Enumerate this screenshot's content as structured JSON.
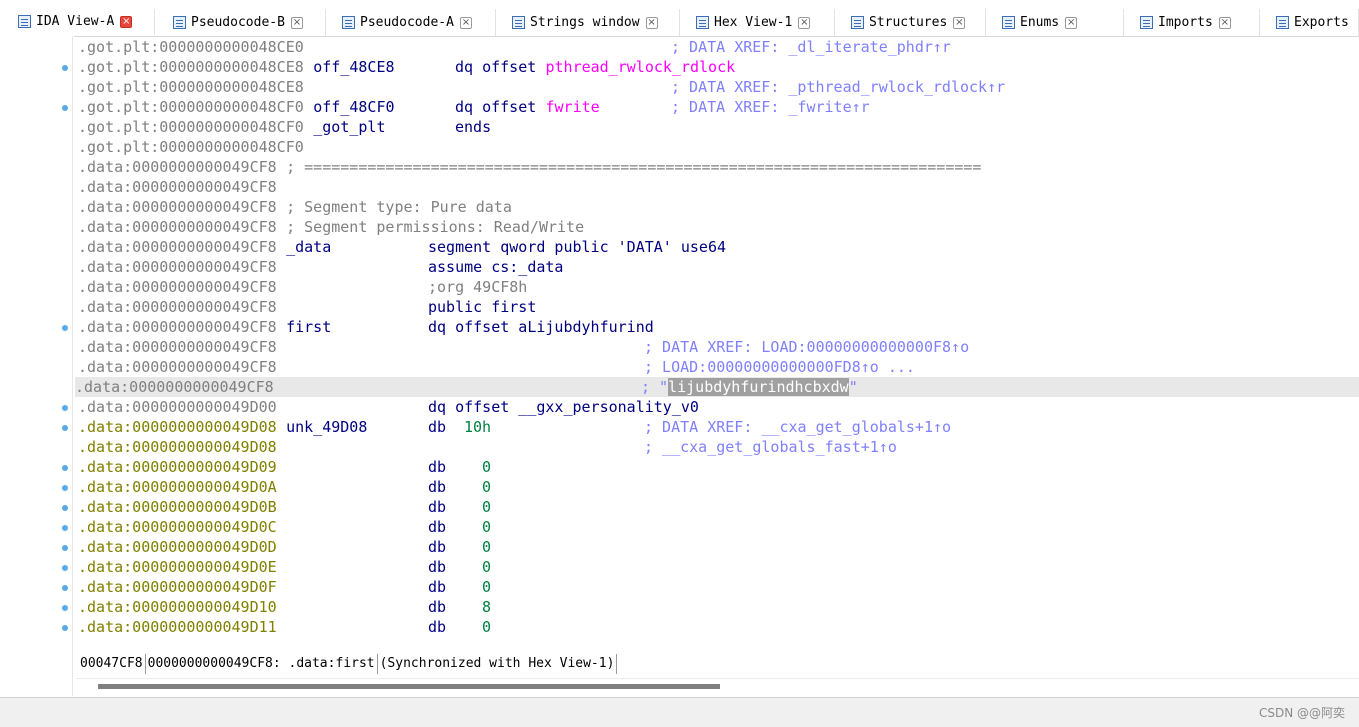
{
  "tabs": [
    {
      "label": "IDA View-A",
      "icon": "ida-view-icon",
      "active": true
    },
    {
      "label": "Pseudocode-B",
      "icon": "pseudocode-icon",
      "active": false
    },
    {
      "label": "Pseudocode-A",
      "icon": "pseudocode-icon",
      "active": false
    },
    {
      "label": "Strings window",
      "icon": "strings-icon",
      "active": false
    },
    {
      "label": "Hex View-1",
      "icon": "hex-view-icon",
      "active": false
    },
    {
      "label": "Structures",
      "icon": "structures-icon",
      "active": false
    },
    {
      "label": "Enums",
      "icon": "enums-icon",
      "active": false
    },
    {
      "label": "Imports",
      "icon": "imports-icon",
      "active": false
    },
    {
      "label": "Exports",
      "icon": "exports-icon",
      "active": false
    }
  ],
  "close_glyph": "×",
  "listing": [
    {
      "addr": ".got.plt:0000000000048CE0",
      "addr_color": "gray",
      "name": "",
      "mnem": "",
      "op": "",
      "comment": "; DATA XREF: _dl_iterate_phdr↑r",
      "dot": false
    },
    {
      "addr": ".got.plt:0000000000048CE8",
      "addr_color": "gray",
      "name": "off_48CE8",
      "mnem": "dq offset",
      "op": "pthread_rwlock_rdlock",
      "op_color": "purple",
      "comment": "",
      "dot": true
    },
    {
      "addr": ".got.plt:0000000000048CE8",
      "addr_color": "gray",
      "name": "",
      "mnem": "",
      "op": "",
      "comment": "; DATA XREF: _pthread_rwlock_rdlock↑r",
      "dot": false
    },
    {
      "addr": ".got.plt:0000000000048CF0",
      "addr_color": "gray",
      "name": "off_48CF0",
      "mnem": "dq offset",
      "op": "fwrite",
      "op_color": "purple",
      "comment": "; DATA XREF: _fwrite↑r",
      "dot": true
    },
    {
      "addr": ".got.plt:0000000000048CF0",
      "addr_color": "gray",
      "name": "_got_plt",
      "mnem": "ends",
      "op": "",
      "comment": "",
      "dot": false
    },
    {
      "addr": ".got.plt:0000000000048CF0",
      "addr_color": "gray",
      "name": "",
      "mnem": "",
      "op": "",
      "comment": "",
      "dot": false
    },
    {
      "addr": ".data:0000000000049CF8",
      "addr_color": "gray",
      "raw": "; ===========================================================================",
      "dot": false
    },
    {
      "addr": ".data:0000000000049CF8",
      "addr_color": "gray",
      "raw": "",
      "dot": false
    },
    {
      "addr": ".data:0000000000049CF8",
      "addr_color": "gray",
      "raw": "; Segment type: Pure data",
      "dot": false
    },
    {
      "addr": ".data:0000000000049CF8",
      "addr_color": "gray",
      "raw": "; Segment permissions: Read/Write",
      "dot": false
    },
    {
      "addr": ".data:0000000000049CF8",
      "addr_color": "gray",
      "name": "_data",
      "mnem": "segment qword public 'DATA' use64",
      "op": "",
      "comment": "",
      "dot": false
    },
    {
      "addr": ".data:0000000000049CF8",
      "addr_color": "gray",
      "name": "",
      "mnem": "assume cs:_data",
      "op": "",
      "comment": "",
      "dot": false
    },
    {
      "addr": ".data:0000000000049CF8",
      "addr_color": "gray",
      "name": "",
      "mnem_gray": ";org 49CF8h",
      "op": "",
      "comment": "",
      "dot": false
    },
    {
      "addr": ".data:0000000000049CF8",
      "addr_color": "gray",
      "name": "",
      "mnem": "public first",
      "op": "",
      "comment": "",
      "dot": false
    },
    {
      "addr": ".data:0000000000049CF8",
      "addr_color": "gray",
      "name": "first",
      "mnem": "dq offset aLijubdyhfurind",
      "op": "",
      "comment": "",
      "dot": true
    },
    {
      "addr": ".data:0000000000049CF8",
      "addr_color": "gray",
      "name": "",
      "mnem": "",
      "op": "",
      "comment2": "; DATA XREF: LOAD:00000000000000F8↑o",
      "dot": false
    },
    {
      "addr": ".data:0000000000049CF8",
      "addr_color": "gray",
      "name": "",
      "mnem": "",
      "op": "",
      "comment2": "; LOAD:00000000000000FD8↑o ...",
      "dot": false
    },
    {
      "addr": ".data:0000000000049CF8",
      "addr_color": "gray",
      "name": "",
      "mnem": "",
      "op": "",
      "comment_pre": "; \"",
      "comment_sel": "lijubdyhfurindhcbxdw",
      "comment_post": "\"",
      "highlight": true,
      "dot": false
    },
    {
      "addr": ".data:0000000000049D00",
      "addr_color": "gray",
      "name": "",
      "mnem": "dq offset __gxx_personality_v0",
      "op": "",
      "comment": "",
      "dot": true
    },
    {
      "addr": ".data:0000000000049D08",
      "addr_color": "olive",
      "name": "unk_49D08",
      "mnem": "db",
      "num": "10h",
      "comment2": "; DATA XREF: __cxa_get_globals+1↑o",
      "dot": true
    },
    {
      "addr": ".data:0000000000049D08",
      "addr_color": "olive",
      "name": "",
      "mnem": "",
      "op": "",
      "comment2": "; __cxa_get_globals_fast+1↑o",
      "dot": false
    },
    {
      "addr": ".data:0000000000049D09",
      "addr_color": "olive",
      "name": "",
      "mnem": "db",
      "num": "0",
      "dot": true
    },
    {
      "addr": ".data:0000000000049D0A",
      "addr_color": "olive",
      "name": "",
      "mnem": "db",
      "num": "0",
      "dot": true
    },
    {
      "addr": ".data:0000000000049D0B",
      "addr_color": "olive",
      "name": "",
      "mnem": "db",
      "num": "0",
      "dot": true
    },
    {
      "addr": ".data:0000000000049D0C",
      "addr_color": "olive",
      "name": "",
      "mnem": "db",
      "num": "0",
      "dot": true
    },
    {
      "addr": ".data:0000000000049D0D",
      "addr_color": "olive",
      "name": "",
      "mnem": "db",
      "num": "0",
      "dot": true
    },
    {
      "addr": ".data:0000000000049D0E",
      "addr_color": "olive",
      "name": "",
      "mnem": "db",
      "num": "0",
      "dot": true
    },
    {
      "addr": ".data:0000000000049D0F",
      "addr_color": "olive",
      "name": "",
      "mnem": "db",
      "num": "0",
      "dot": true
    },
    {
      "addr": ".data:0000000000049D10",
      "addr_color": "olive",
      "name": "",
      "mnem": "db",
      "num": "8",
      "dot": true
    },
    {
      "addr": ".data:0000000000049D11",
      "addr_color": "olive",
      "name": "",
      "mnem": "db",
      "num": "0",
      "dot": true
    }
  ],
  "status": {
    "offset": "00047CF8",
    "location": "0000000000049CF8: .data:first",
    "sync": "(Synchronized with Hex View-1)"
  },
  "watermark": "CSDN @@阿奕",
  "colors": {
    "address_gray": "#808080",
    "address_olive": "#808000",
    "name_navy": "#000080",
    "import_magenta": "#ff00ff",
    "xref_comment": "#8080ff",
    "number_green": "#008040",
    "gutter_dot": "#5aa8e6",
    "active_close": "#e9463b"
  }
}
